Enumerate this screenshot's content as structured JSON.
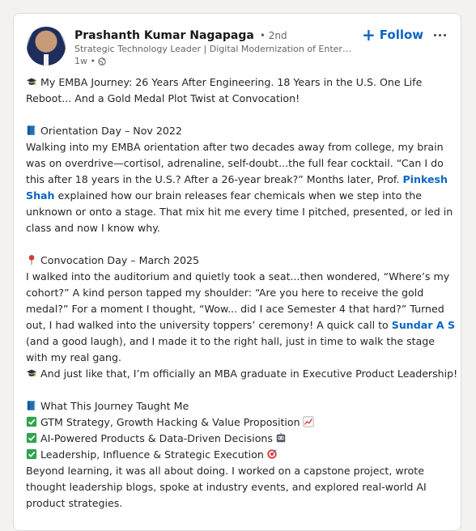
{
  "post": {
    "author": {
      "name": "Prashanth Kumar Nagapaga",
      "degree": "• 2nd",
      "headline": "Strategic Technology Leader | Digital Modernization of Enterprise Systems",
      "time": "1w •"
    },
    "actions": {
      "follow_label": "Follow"
    },
    "body": {
      "intro_1": "My EMBA Journey: 26 Years After Engineering. 18 Years in the U.S. One Life",
      "intro_2": "Reboot... And a Gold Medal Plot Twist at Convocation!",
      "orientation_heading": "Orientation Day – Nov 2022",
      "orientation_1": "Walking into my EMBA orientation after two decades away from college, my brain",
      "orientation_2": "was on overdrive—cortisol, adrenaline, self-doubt...the full fear cocktail. “Can I do",
      "orientation_3": "this after 18 years in the U.S.? After a 26-year break?” Months later, Prof.",
      "orientation_mention_1": "Pinkesh",
      "orientation_mention_2": "Shah",
      "orientation_4_rest": "explained how our brain releases fear chemicals when we step into the",
      "orientation_5": "unknown or onto a stage. That mix hit me every time I pitched, presented, or led in",
      "orientation_6": "class and now I know why.",
      "convocation_heading": "Convocation Day – March 2025",
      "convocation_1": "I walked into the auditorium and quietly took a seat...then wondered, “Where’s my",
      "convocation_2": "cohort?” A kind person tapped my shoulder: “Are you here to receive the gold",
      "convocation_3": "medal?” For a moment I thought, “Wow... did I ace Semester 4 that hard?” Turned",
      "convocation_4": "out, I had walked into the university toppers’ ceremony! A quick call to",
      "convocation_mention": "Sundar A S",
      "convocation_5": "(and a good laugh), and I made it to the right hall, just in time to walk the stage",
      "convocation_6": "with my real gang.",
      "graduate_line": "And just like that, I’m officially an MBA graduate in Executive Product Leadership!",
      "taught_heading": "What This Journey Taught Me",
      "checklist": [
        "GTM Strategy, Growth Hacking & Value Proposition",
        "AI-Powered Products & Data-Driven Decisions",
        "Leadership, Influence & Strategic Execution"
      ],
      "closing_1": "Beyond learning, it was all about doing. I worked on a capstone project, wrote",
      "closing_2": "thought leadership blogs, spoke at industry events, and explored real-world AI",
      "closing_3": "product strategies."
    },
    "icons": {
      "intro": "graduation-cap-icon",
      "orientation": "blue-book-icon",
      "convocation": "red-pushpin-icon",
      "graduate": "graduation-cap-icon",
      "taught": "blue-book-icon",
      "checklist": "green-check-icon",
      "checklist_trailing": [
        "chart-increasing-icon",
        "robot-face-icon",
        "direct-hit-icon"
      ]
    },
    "colors": {
      "link": "#0a66c2",
      "text": "#262626",
      "secondary": "#666666",
      "check_green": "#2ea44f"
    }
  }
}
